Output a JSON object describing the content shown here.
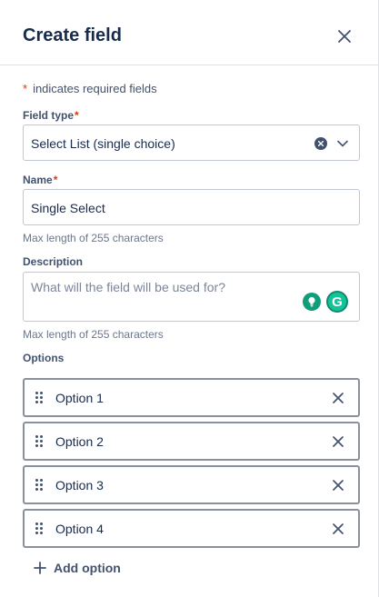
{
  "header": {
    "title": "Create field"
  },
  "required_note": {
    "star": "*",
    "text": "indicates required fields"
  },
  "field_type": {
    "label": "Field type",
    "required_star": "*",
    "selected_value": "Select List (single choice)"
  },
  "name": {
    "label": "Name",
    "required_star": "*",
    "value": "Single Select",
    "hint": "Max length of 255 characters"
  },
  "description": {
    "label": "Description",
    "placeholder": "What will the field will be used for?",
    "hint": "Max length of 255 characters",
    "grammarly_letter": "G"
  },
  "options": {
    "label": "Options",
    "items": [
      {
        "label": "Option 1"
      },
      {
        "label": "Option 2"
      },
      {
        "label": "Option 3"
      },
      {
        "label": "Option 4"
      }
    ],
    "add_label": "Add option"
  },
  "colors": {
    "required_star": "#de350b",
    "text_primary": "#172b4d",
    "text_subtle": "#42526e",
    "hint": "#6b778c",
    "border": "#c1c7d0",
    "option_border": "#8a919c",
    "grammarly_green": "#15c39a"
  }
}
